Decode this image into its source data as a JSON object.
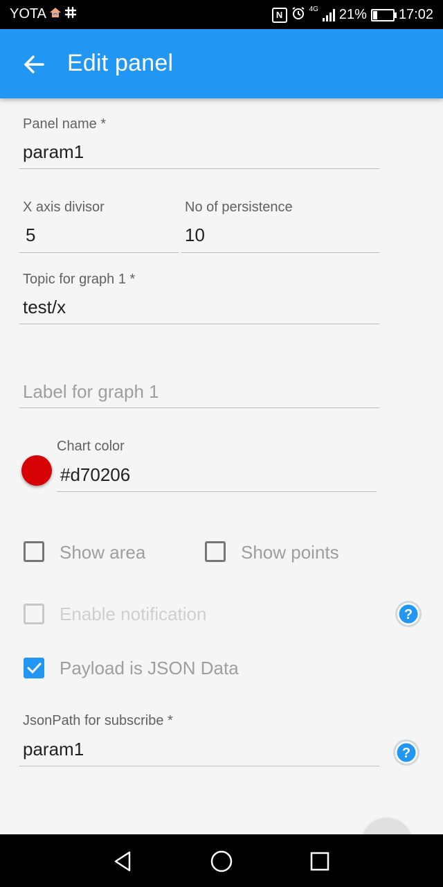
{
  "status_bar": {
    "carrier": "YOTA",
    "battery": "21%",
    "time": "17:02",
    "network": "4G",
    "icons": [
      "home-wifi-icon",
      "slack-icon",
      "nfc-icon",
      "alarm-icon",
      "signal-icon",
      "battery-icon"
    ]
  },
  "app_bar": {
    "title": "Edit panel",
    "back_icon": "arrow-left-icon",
    "color": "#2196f3"
  },
  "form": {
    "panel_name": {
      "label": "Panel name",
      "required": "*",
      "value": "param1"
    },
    "x_axis_divisor": {
      "label": "X axis divisor",
      "value": "5"
    },
    "no_of_persistence": {
      "label": "No of persistence",
      "value": "10"
    },
    "topic_graph1": {
      "label": "Topic for graph 1",
      "required": "*",
      "value": "test/x"
    },
    "label_graph1": {
      "placeholder": "Label for graph 1"
    },
    "chart_color": {
      "label": "Chart color",
      "value": "#d70206"
    },
    "show_area": {
      "label": "Show area",
      "checked": false
    },
    "show_points": {
      "label": "Show points",
      "checked": false
    },
    "enable_notification": {
      "label": "Enable notification",
      "checked": false,
      "disabled": true
    },
    "payload_json": {
      "label": "Payload is JSON Data",
      "checked": true
    },
    "json_path": {
      "label": "JsonPath for subscribe",
      "required": "*",
      "value": "param1"
    }
  },
  "colors": {
    "accent": "#2196f3",
    "help_icon": "#2196f3",
    "chart_dot": "#d70206"
  },
  "nav_bar": {
    "icons": [
      "back-triangle-icon",
      "home-circle-icon",
      "recents-square-icon"
    ]
  }
}
